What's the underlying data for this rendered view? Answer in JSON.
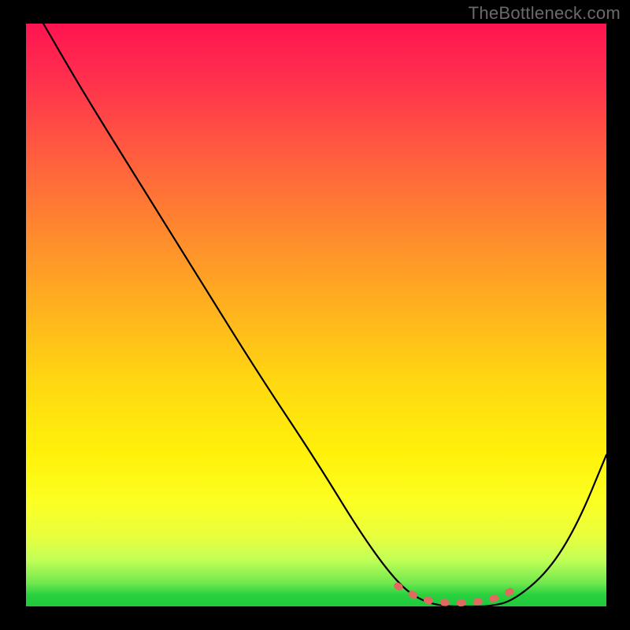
{
  "watermark": "TheBottleneck.com",
  "chart_data": {
    "type": "line",
    "title": "",
    "xlabel": "",
    "ylabel": "",
    "xlim": [
      0,
      100
    ],
    "ylim": [
      0,
      100
    ],
    "grid": false,
    "legend": false,
    "series": [
      {
        "name": "bottleneck-curve",
        "x": [
          3,
          10,
          20,
          30,
          40,
          50,
          58,
          64,
          68,
          72,
          76,
          80,
          84,
          90,
          95,
          100
        ],
        "y": [
          100,
          88,
          72,
          56,
          40,
          25,
          12,
          4,
          1,
          0,
          0,
          0,
          1,
          6,
          14,
          26
        ],
        "color": "#000000"
      }
    ],
    "dotted_segment": {
      "comment": "salmon dotted overlay on the trough of the curve",
      "x": [
        64,
        68,
        72,
        76,
        80,
        84
      ],
      "y": [
        3.5,
        1.2,
        0.6,
        0.6,
        1.0,
        2.8
      ],
      "color": "#e06a60"
    }
  },
  "gradient_stops": [
    {
      "pos": 0.0,
      "color": "#ff1450"
    },
    {
      "pos": 0.5,
      "color": "#ffb51d"
    },
    {
      "pos": 0.8,
      "color": "#fcff22"
    },
    {
      "pos": 1.0,
      "color": "#1ec93d"
    }
  ]
}
